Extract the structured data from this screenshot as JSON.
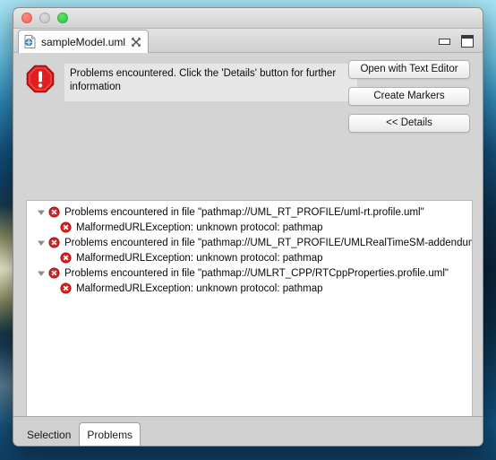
{
  "window": {
    "traffic_lights": [
      "close-button",
      "minimize-button",
      "zoom-button"
    ],
    "editor_tab": {
      "label": "sampleModel.uml",
      "icon": "uml-file-icon",
      "close_icon": "tab-close-icon"
    },
    "controls": {
      "minimize_icon": "minimize-icon",
      "maximize_icon": "maximize-icon"
    }
  },
  "dialog": {
    "error_icon": "error-octagon-icon",
    "message": "Problems encountered.  Click the 'Details' button for further information",
    "buttons": [
      {
        "label": "Open with Text Editor",
        "name": "open-with-text-editor-button"
      },
      {
        "label": "Create Markers",
        "name": "create-markers-button"
      },
      {
        "label": "<< Details",
        "name": "details-button"
      }
    ]
  },
  "details": {
    "rows": [
      {
        "level": 0,
        "expander": "triangle-down-icon",
        "icon": "error-x-icon",
        "text": "Problems encountered in file \"pathmap://UML_RT_PROFILE/uml-rt.profile.uml\""
      },
      {
        "level": 1,
        "expander": null,
        "icon": "error-x-icon",
        "text": "MalformedURLException: unknown protocol: pathmap"
      },
      {
        "level": 0,
        "expander": "triangle-down-icon",
        "icon": "error-x-icon",
        "text": "Problems encountered in file \"pathmap://UML_RT_PROFILE/UMLRealTimeSM-addendum"
      },
      {
        "level": 1,
        "expander": null,
        "icon": "error-x-icon",
        "text": "MalformedURLException: unknown protocol: pathmap"
      },
      {
        "level": 0,
        "expander": "triangle-down-icon",
        "icon": "error-x-icon",
        "text": "Problems encountered in file \"pathmap://UMLRT_CPP/RTCppProperties.profile.uml\""
      },
      {
        "level": 1,
        "expander": null,
        "icon": "error-x-icon",
        "text": "MalformedURLException: unknown protocol: pathmap"
      }
    ],
    "scrollbar": {
      "name": "horizontal-scrollbar",
      "thumb_width_percent": 89
    }
  },
  "bottom_tabs": [
    {
      "label": "Selection",
      "name": "tab-selection",
      "active": false
    },
    {
      "label": "Problems",
      "name": "tab-problems",
      "active": true
    }
  ],
  "colors": {
    "error_red": "#d01414",
    "window_chrome": "#d4d4d4",
    "panel_white": "#ffffff",
    "traffic_close": "#ff5f57",
    "traffic_min": "#c6c6c6",
    "traffic_max": "#28c840"
  }
}
